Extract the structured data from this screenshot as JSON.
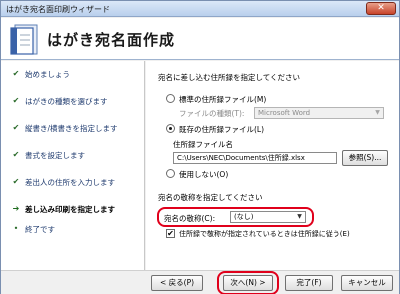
{
  "window": {
    "title": "はがき宛名面印刷ウィザード",
    "close_glyph": "✕"
  },
  "header": {
    "heading": "はがき宛名面作成"
  },
  "sidebar": {
    "steps": [
      {
        "mark": "✔",
        "label": "始めましょう"
      },
      {
        "mark": "✔",
        "label": "はがきの種類を選びます"
      },
      {
        "mark": "✔",
        "label": "縦書き/横書きを指定します"
      },
      {
        "mark": "✔",
        "label": "書式を設定します"
      },
      {
        "mark": "✔",
        "label": "差出人の住所を入力します"
      },
      {
        "mark": "➔",
        "label": "差し込み印刷を指定します"
      },
      {
        "mark": "•",
        "label": "終了です"
      }
    ]
  },
  "address_source": {
    "title": "宛名に差し込む住所録を指定してください",
    "option_standard": "標準の住所録ファイル(M)",
    "file_type_label": "ファイルの種類(T):",
    "file_type_value": "Microsoft Word",
    "option_existing": "既存の住所録ファイル(L)",
    "file_name_label": "住所録ファイル名",
    "file_path": "C:\\Users\\NEC\\Documents\\住所録.xlsx",
    "browse_button": "参照(S)...",
    "option_none": "使用しない(O)"
  },
  "title_settings": {
    "title": "宛名の敬称を指定してください",
    "honorific_label": "宛名の敬称(C):",
    "honorific_value": "(なし)",
    "follow_addressbook_label": "住所録で敬称が指定されているときは住所録に従う(E)",
    "follow_checked": "✔"
  },
  "footer": {
    "back_button": "< 戻る(P)",
    "next_button": "次へ(N) >",
    "finish_button": "完了(F)",
    "cancel_button": "キャンセル"
  },
  "colors": {
    "highlight_ring": "#e0001b"
  },
  "icons": {
    "steps_done": "checkmark-icon",
    "step_current": "arrow-right-icon",
    "step_pending": "bullet-icon",
    "wizard": "document-wizard-icon"
  }
}
